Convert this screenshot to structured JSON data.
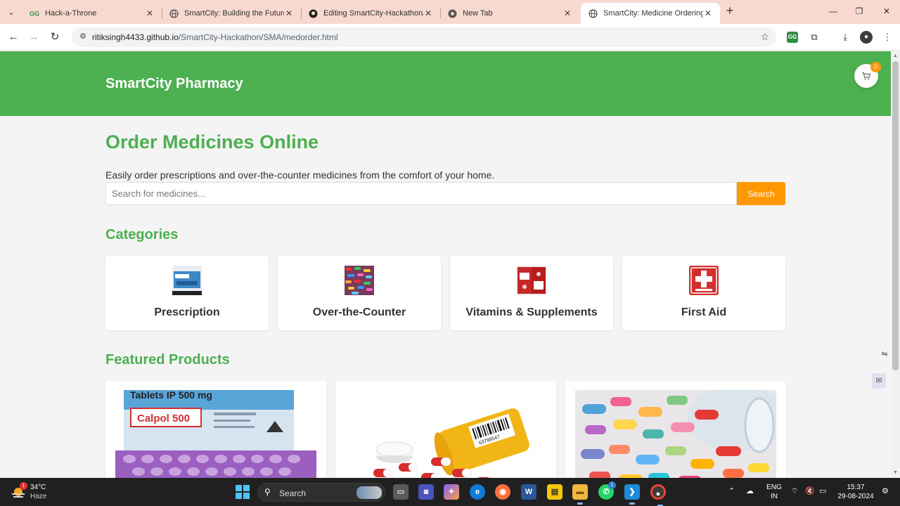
{
  "browser": {
    "tabs": [
      {
        "title": "Hack-a-Throne",
        "favicon": "gfg-icon",
        "active": false
      },
      {
        "title": "SmartCity: Building the Future",
        "favicon": "globe-icon",
        "active": false
      },
      {
        "title": "Editing SmartCity-Hackathon/R",
        "favicon": "github-icon",
        "active": false
      },
      {
        "title": "New Tab",
        "favicon": "chrome-icon",
        "active": false
      },
      {
        "title": "SmartCity: Medicine Ordering",
        "favicon": "globe-icon",
        "active": true
      }
    ],
    "url_host": "ritiksingh4433.github.io",
    "url_path": "/SmartCity-Hackathon/SMA/medorder.html"
  },
  "header": {
    "title": "SmartCity Pharmacy",
    "cart_count": "0"
  },
  "main": {
    "title": "Order Medicines Online",
    "intro": "Easily order prescriptions and over-the-counter medicines from the comfort of your home.",
    "search": {
      "placeholder": "Search for medicines...",
      "button_label": "Search"
    }
  },
  "categories": {
    "title": "Categories",
    "items": [
      {
        "name": "Prescription",
        "icon": "medicine-box-icon"
      },
      {
        "name": "Over-the-Counter",
        "icon": "pills-icon"
      },
      {
        "name": "Vitamins & Supplements",
        "icon": "supplement-pack-icon"
      },
      {
        "name": "First Aid",
        "icon": "first-aid-kit-icon"
      }
    ]
  },
  "featured": {
    "title": "Featured Products",
    "products": [
      {
        "image": "calpol-tablets-image",
        "pack_heading": "Tablets IP 500 mg",
        "pack_brand": "Calpol 500"
      },
      {
        "image": "pill-bottle-image",
        "bottle_code": "63798547"
      },
      {
        "image": "colorful-capsules-image"
      }
    ]
  },
  "taskbar": {
    "weather_temp": "34°C",
    "weather_condition": "Haze",
    "weather_badge": "1",
    "search_label": "Search",
    "whatsapp_badge": "1",
    "lang_line1": "ENG",
    "lang_line2": "IN",
    "time": "15:37",
    "date": "29-08-2024"
  },
  "colors": {
    "brand_green": "#4caf50",
    "accent_orange": "#ff9800"
  }
}
